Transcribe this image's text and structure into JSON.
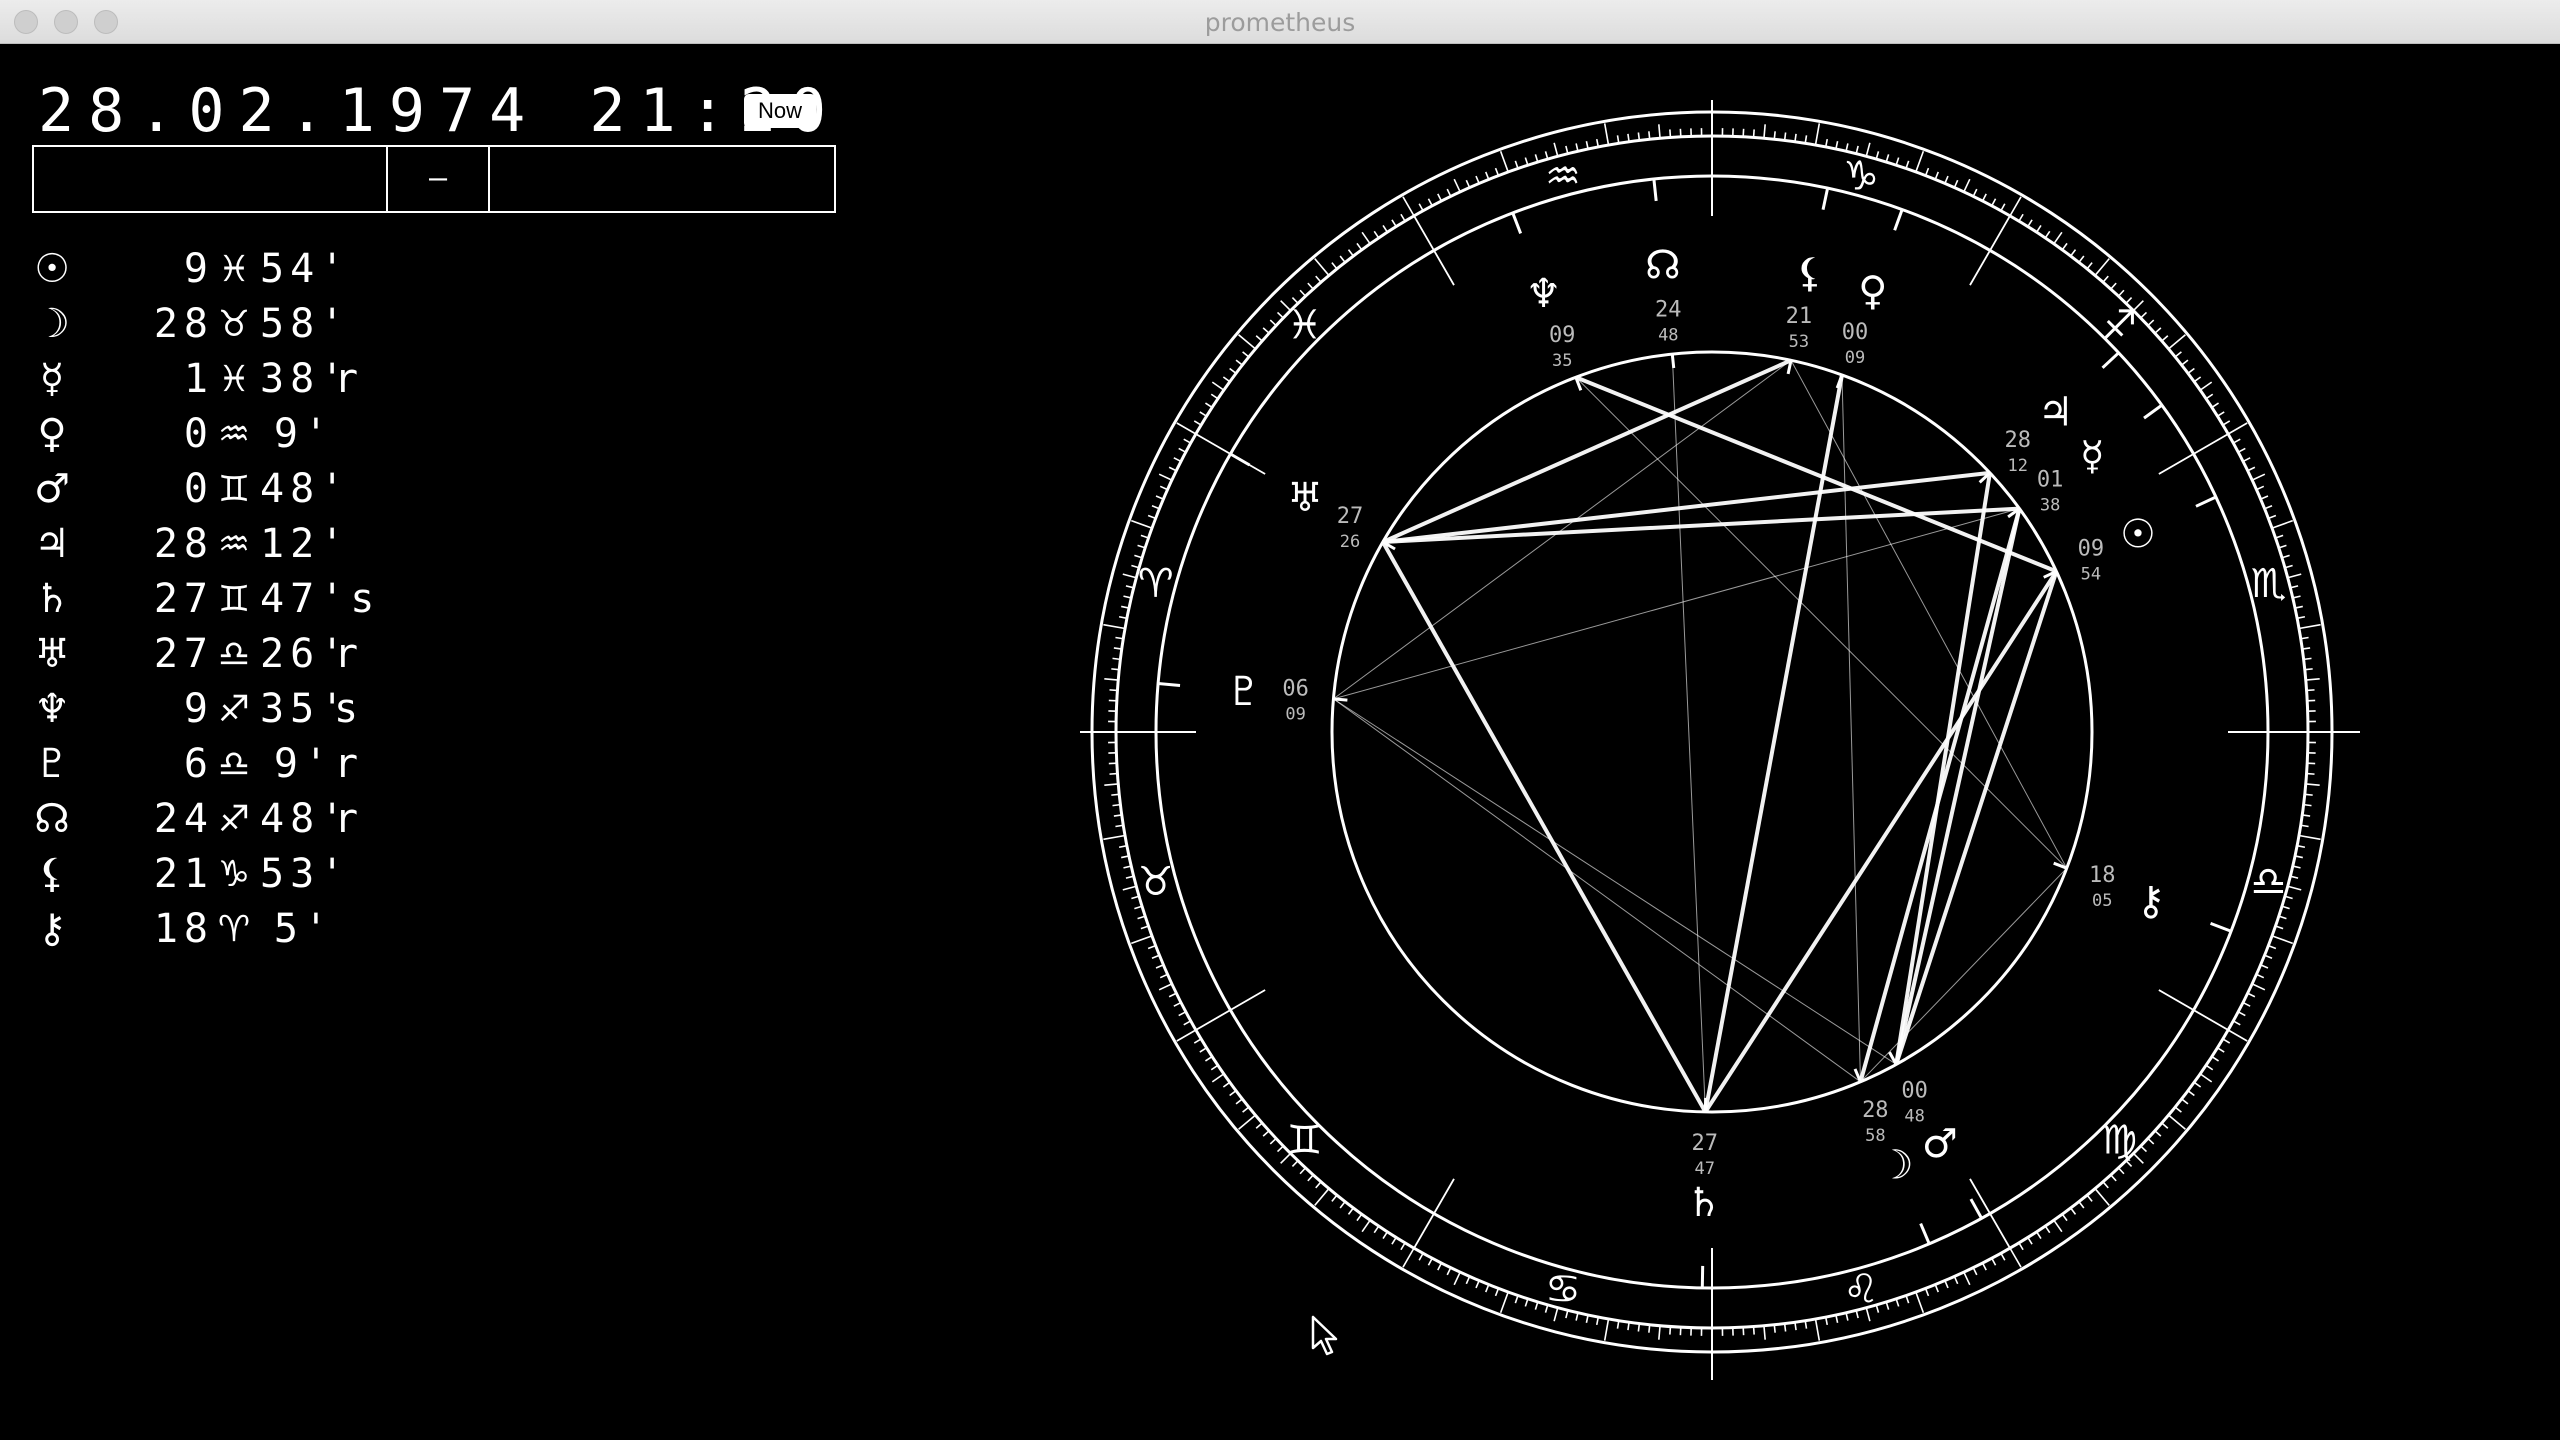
{
  "window": {
    "title": "prometheus"
  },
  "header": {
    "datetime": "28.02.1974 21:20",
    "now_button": "Now",
    "input_left": "",
    "input_separator": "–",
    "input_right": ""
  },
  "planets": [
    {
      "name": "sun-icon",
      "symbol": "☉",
      "deg": "9",
      "sign": "♓",
      "min": "54'",
      "suffix": ""
    },
    {
      "name": "moon-icon",
      "symbol": "☽",
      "deg": "28",
      "sign": "♉",
      "min": "58'",
      "suffix": ""
    },
    {
      "name": "mercury-icon",
      "symbol": "☿",
      "deg": "1",
      "sign": "♓",
      "min": "38'",
      "suffix": "r"
    },
    {
      "name": "venus-icon",
      "symbol": "♀",
      "deg": "0",
      "sign": "♒",
      "min": "9'",
      "suffix": ""
    },
    {
      "name": "mars-icon",
      "symbol": "♂",
      "deg": "0",
      "sign": "♊",
      "min": "48'",
      "suffix": ""
    },
    {
      "name": "jupiter-icon",
      "symbol": "♃",
      "deg": "28",
      "sign": "♒",
      "min": "12'",
      "suffix": ""
    },
    {
      "name": "saturn-icon",
      "symbol": "♄",
      "deg": "27",
      "sign": "♊",
      "min": "47's",
      "suffix": ""
    },
    {
      "name": "uranus-icon",
      "symbol": "♅",
      "deg": "27",
      "sign": "♎",
      "min": "26'",
      "suffix": "r"
    },
    {
      "name": "neptune-icon",
      "symbol": "♆",
      "deg": "9",
      "sign": "♐",
      "min": "35'",
      "suffix": "s"
    },
    {
      "name": "pluto-icon",
      "symbol": "♇",
      "deg": "6",
      "sign": "♎",
      "min": "9'",
      "suffix": "r"
    },
    {
      "name": "north-node-icon",
      "symbol": "☊",
      "deg": "24",
      "sign": "♐",
      "min": "48'",
      "suffix": "r"
    },
    {
      "name": "lilith-icon",
      "symbol": "⚸",
      "deg": "21",
      "sign": "♑",
      "min": "53'",
      "suffix": ""
    },
    {
      "name": "chiron-icon",
      "symbol": "⚷",
      "deg": "18",
      "sign": "♈",
      "min": "5'",
      "suffix": ""
    }
  ],
  "wheel": {
    "signs": [
      {
        "glyph": "♑",
        "longitude": 15
      },
      {
        "glyph": "♐",
        "longitude": 45
      },
      {
        "glyph": "♏",
        "longitude": 75
      },
      {
        "glyph": "♎",
        "longitude": 105
      },
      {
        "glyph": "♍",
        "longitude": 135
      },
      {
        "glyph": "♌",
        "longitude": 165
      },
      {
        "glyph": "♋",
        "longitude": 195
      },
      {
        "glyph": "♊",
        "longitude": 225
      },
      {
        "glyph": "♉",
        "longitude": 255
      },
      {
        "glyph": "♈",
        "longitude": 285
      },
      {
        "glyph": "♓",
        "longitude": 315
      },
      {
        "glyph": "♒",
        "longitude": 345
      }
    ],
    "bodies": [
      {
        "glyph": "☊",
        "deg": "24",
        "min": "48",
        "longitude": 354
      },
      {
        "glyph": "♆",
        "deg": "09",
        "min": "35",
        "longitude": 339
      },
      {
        "glyph": "⚸",
        "deg": "21",
        "min": "53",
        "longitude": 12
      },
      {
        "glyph": "♀",
        "deg": "00",
        "min": "09",
        "longitude": 20
      },
      {
        "glyph": "♃",
        "deg": "28",
        "min": "12",
        "longitude": 47
      },
      {
        "glyph": "☿",
        "deg": "01",
        "min": "38",
        "longitude": 54
      },
      {
        "glyph": "☉",
        "deg": "09",
        "min": "54",
        "longitude": 65
      },
      {
        "glyph": "♅",
        "deg": "27",
        "min": "26",
        "longitude": 300
      },
      {
        "glyph": "♇",
        "deg": "06",
        "min": "09",
        "longitude": 275
      },
      {
        "glyph": "⚷",
        "deg": "18",
        "min": "05",
        "longitude": 111
      },
      {
        "glyph": "☽",
        "deg": "28",
        "min": "58",
        "longitude": 157
      },
      {
        "glyph": "♂",
        "deg": "00",
        "min": "48",
        "longitude": 151
      },
      {
        "glyph": "♄",
        "deg": "27",
        "min": "47",
        "longitude": 181
      }
    ],
    "aspects": [
      [
        12,
        275,
        1
      ],
      [
        12,
        300,
        4
      ],
      [
        12,
        111,
        1
      ],
      [
        20,
        181,
        4
      ],
      [
        20,
        157,
        1
      ],
      [
        47,
        300,
        4
      ],
      [
        54,
        300,
        4
      ],
      [
        54,
        275,
        1
      ],
      [
        54,
        151,
        4
      ],
      [
        54,
        157,
        4
      ],
      [
        65,
        181,
        4
      ],
      [
        65,
        151,
        4
      ],
      [
        65,
        339,
        4
      ],
      [
        181,
        300,
        4
      ],
      [
        181,
        354,
        1
      ],
      [
        111,
        339,
        1
      ],
      [
        111,
        157,
        1
      ],
      [
        151,
        275,
        1
      ],
      [
        157,
        275,
        1
      ],
      [
        47,
        151,
        4
      ]
    ]
  }
}
